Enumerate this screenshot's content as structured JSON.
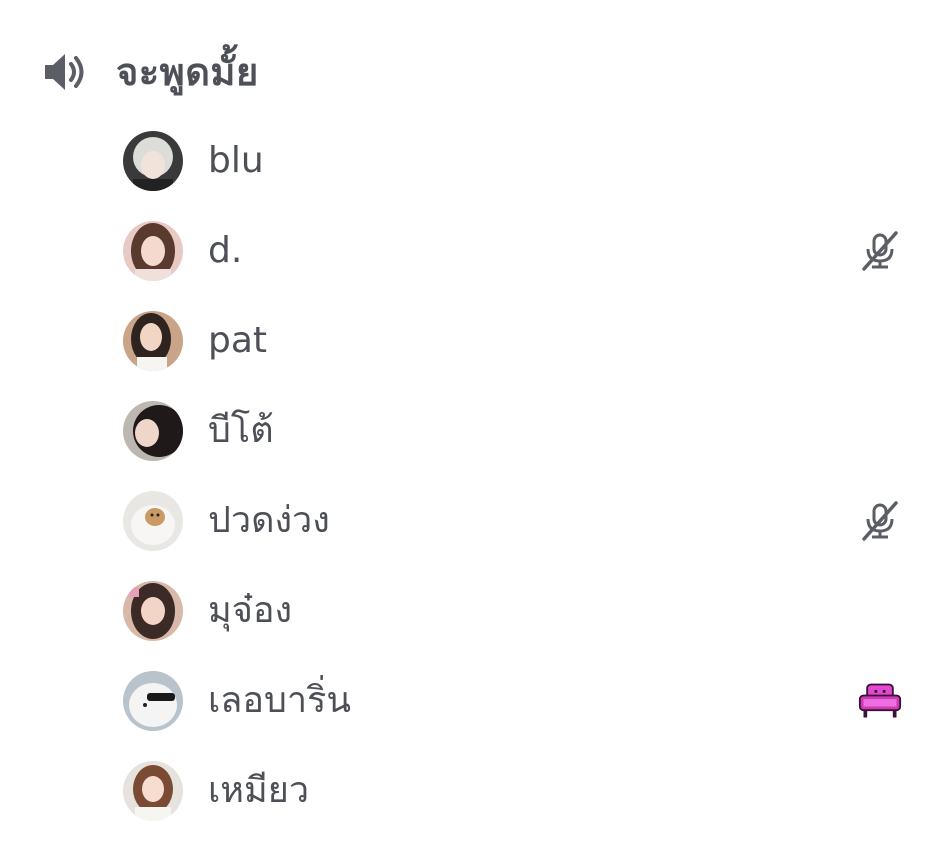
{
  "channel": {
    "name": "จะพูดมั้ย",
    "icon": "speaker-icon"
  },
  "users": [
    {
      "name": "blu",
      "status_icon": null
    },
    {
      "name": "d.",
      "status_icon": "muted-mic-icon"
    },
    {
      "name": "pat",
      "status_icon": null
    },
    {
      "name": "บีโต้",
      "status_icon": null
    },
    {
      "name": "ปวดง่วง",
      "status_icon": "muted-mic-icon"
    },
    {
      "name": "มุจ๋อง",
      "status_icon": null
    },
    {
      "name": "เลอบาริ่น",
      "status_icon": "pink-couch-emoji"
    },
    {
      "name": "เหมียว",
      "status_icon": null
    }
  ],
  "colors": {
    "text": "#4e5058",
    "icon": "#5c5e66",
    "couch": "#e24ad0"
  }
}
